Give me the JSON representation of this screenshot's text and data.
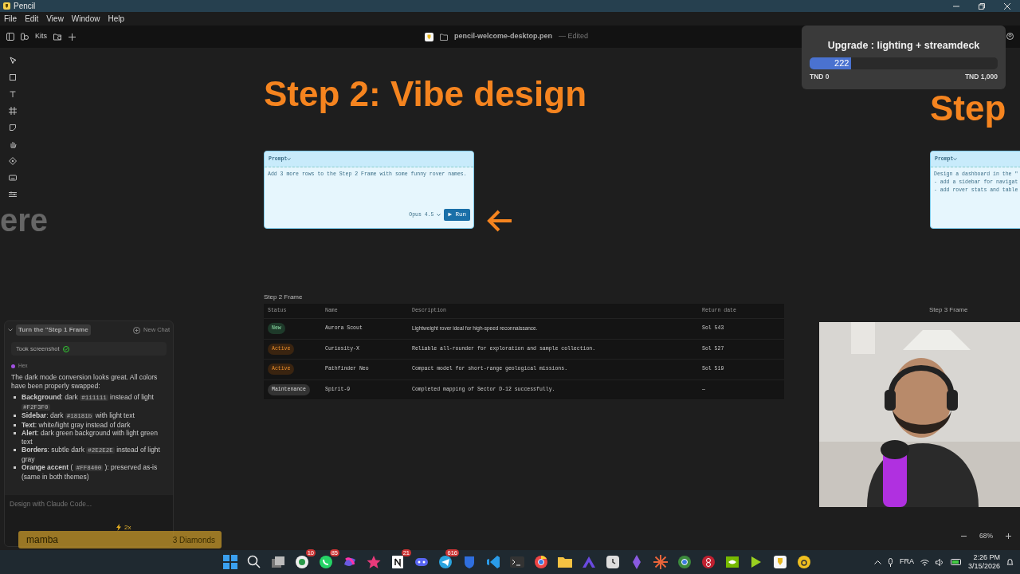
{
  "window": {
    "title": "Pencil"
  },
  "menu": [
    "File",
    "Edit",
    "View",
    "Window",
    "Help"
  ],
  "toolbar": {
    "kits": "Kits",
    "file_name": "pencil-welcome-desktop.pen",
    "file_state": "— Edited"
  },
  "canvas": {
    "side_text": "ere",
    "steps": [
      {
        "heading": "Step 2: Vibe design",
        "prompt": {
          "label": "Prompt",
          "lines": [
            "Add 3 more rows to the Step 2 Frame with some funny rover names."
          ],
          "model": "Opus 4.5",
          "run": "▶ Run"
        }
      },
      {
        "heading": "Step",
        "prompt": {
          "label": "Prompt",
          "lines": [
            "Design a dashboard in the \"",
            "- add a sidebar for navigat",
            "- add rover stats and table"
          ]
        }
      }
    ],
    "frame_title": "Step 2 Frame",
    "table": {
      "columns": [
        "Status",
        "Name",
        "Description",
        "Return date"
      ],
      "rows": [
        {
          "status": "New",
          "kind": "new",
          "name": "Aurora Scout",
          "description": "Lightweight rover ideal for high-speed reconnaissance.",
          "return_date": "Sol 543"
        },
        {
          "status": "Active",
          "kind": "active",
          "name": "Curiosity-X",
          "description": "Reliable all-rounder for exploration and sample collection.",
          "return_date": "Sol 527"
        },
        {
          "status": "Active",
          "kind": "active",
          "name": "Pathfinder Neo",
          "description": "Compact model for short-range geological missions.",
          "return_date": "Sol 519"
        },
        {
          "status": "Maintenance",
          "kind": "maintenance",
          "name": "Spirit-9",
          "description": "Completed mapping of Sector D-12 successfully.",
          "return_date": "—"
        }
      ]
    },
    "next_frame_title": "Step 3 Frame"
  },
  "chat": {
    "title": "Turn the \"Step 1 Frame",
    "new_chat": "New Chat",
    "steps": [
      {
        "label": "Took screenshot",
        "done": true
      }
    ],
    "author": "Hex",
    "message": "The dark mode conversion looks great. All colors have been properly swapped:",
    "bullets": [
      {
        "term": "Background",
        "parts": [
          {
            "kind": "text",
            "text": ": dark "
          },
          {
            "kind": "code",
            "text": "#111111"
          },
          {
            "kind": "text",
            "text": " instead of light "
          },
          {
            "kind": "code",
            "text": "#F2F3F0"
          }
        ]
      },
      {
        "term": "Sidebar",
        "parts": [
          {
            "kind": "text",
            "text": ": dark "
          },
          {
            "kind": "code",
            "text": "#18181b"
          },
          {
            "kind": "text",
            "text": " with light text"
          }
        ]
      },
      {
        "term": "Text",
        "parts": [
          {
            "kind": "text",
            "text": ": white/light gray instead of dark"
          }
        ]
      },
      {
        "term": "Alert",
        "parts": [
          {
            "kind": "text",
            "text": ": dark green background with light green text"
          }
        ]
      },
      {
        "term": "Borders",
        "parts": [
          {
            "kind": "text",
            "text": ": subtle dark "
          },
          {
            "kind": "code",
            "text": "#2E2E2E"
          },
          {
            "kind": "text",
            "text": " instead of light gray"
          }
        ]
      },
      {
        "term": "Orange accent",
        "parts": [
          {
            "kind": "text",
            "text": " ( "
          },
          {
            "kind": "code",
            "text": "#FF8400"
          },
          {
            "kind": "text",
            "text": " ): preserved as-is (same in both themes)"
          }
        ]
      }
    ],
    "placeholder": "Design with Claude Code...",
    "multiplier": "2x"
  },
  "stream_alert": {
    "name": "mamba",
    "amount": "3 Diamonds"
  },
  "upgrade": {
    "title": "Upgrade : lighting + streamdeck",
    "level": 0.222,
    "reading": "222",
    "min": "TND 0",
    "max": "TND 1,000"
  },
  "zoom": "68%",
  "taskbar": {
    "badges": [
      "10",
      "85",
      "21",
      "616"
    ],
    "language": "FRA",
    "time": "2:26 PM",
    "date": "3/15/2026"
  }
}
